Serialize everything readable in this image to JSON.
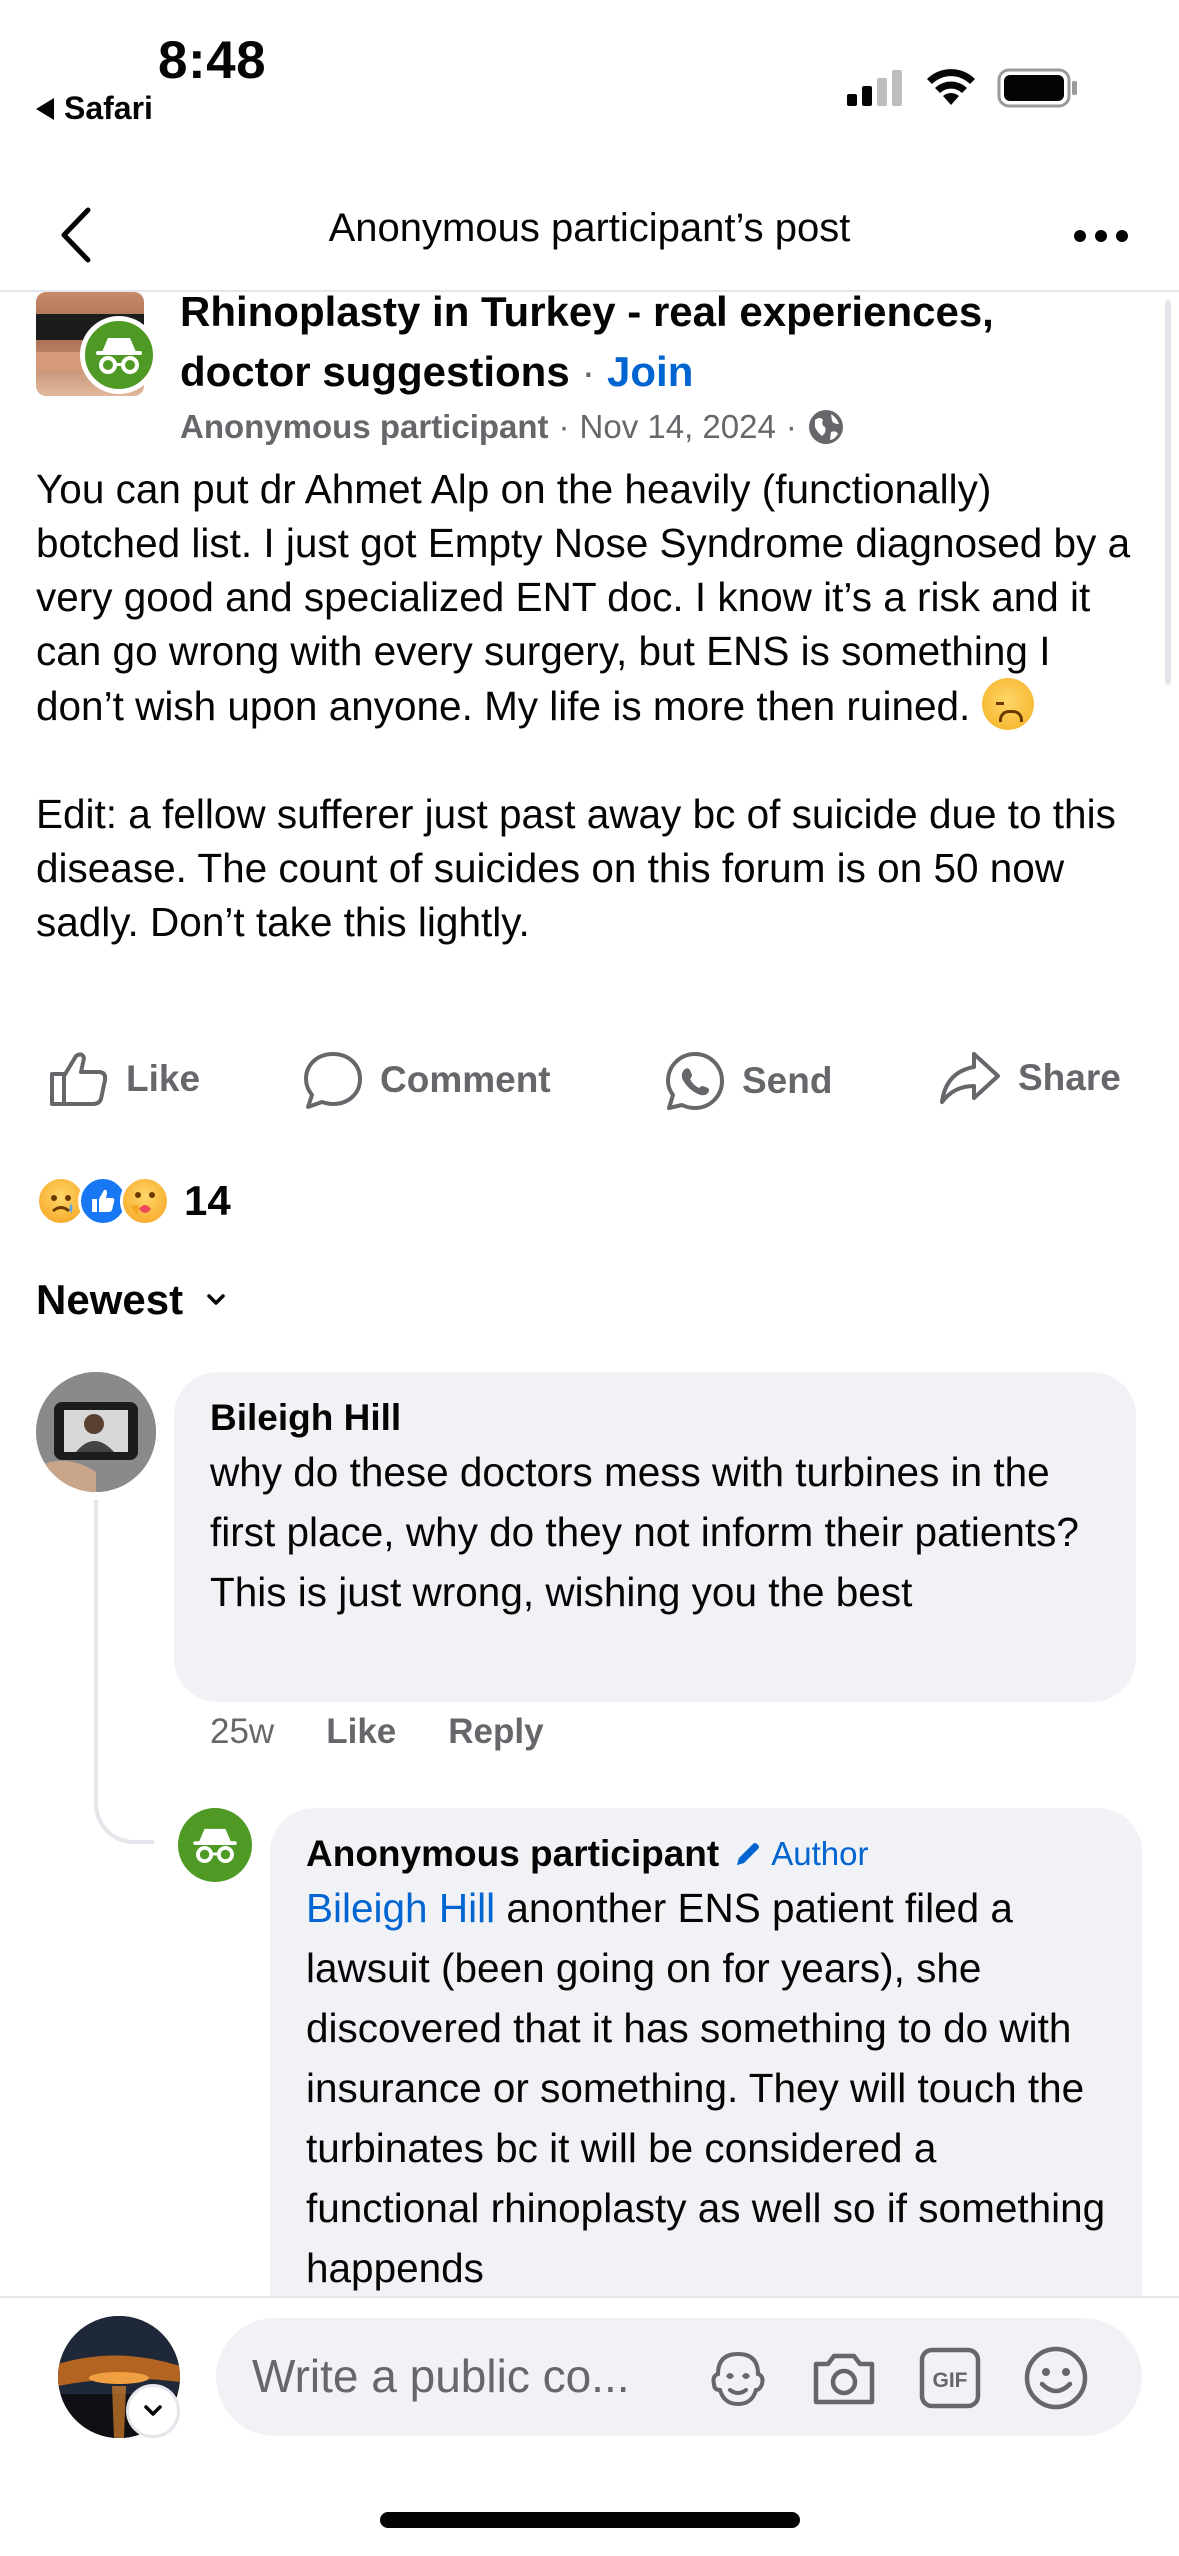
{
  "status": {
    "time": "8:48",
    "back_app": "Safari"
  },
  "nav": {
    "title": "Anonymous participant’s post"
  },
  "post": {
    "group_name": "Rhinoplasty in Turkey - real experiences, doctor suggestions",
    "separator": "·",
    "join_label": "Join",
    "author": "Anonymous participant",
    "meta_sep": "·",
    "date": "Nov 14, 2024",
    "meta_sep2": "·",
    "body_p1": "You can put dr Ahmet Alp on the heavily (functionally) botched list. I just got Empty Nose Syndrome diagnosed by a very good and specialized ENT doc. I know it’s a risk and it can go wrong with every surgery, but ENS is something I don’t wish upon anyone. My life is more then ruined. ",
    "body_p2": "Edit: a fellow sufferer just past away bc of suicide due to this disease. The count of suicides on this forum is on 50 now sadly. Don’t take this lightly."
  },
  "actions": {
    "like": "Like",
    "comment": "Comment",
    "send": "Send",
    "share": "Share"
  },
  "reactions": {
    "types": [
      "sad",
      "like",
      "care"
    ],
    "count": "14"
  },
  "sort": {
    "label": "Newest"
  },
  "comments": [
    {
      "name": "Bileigh Hill",
      "text": "why do these doctors mess with turbines in the first place, why do they not inform their patients? This is just wrong, wishing you the best",
      "time": "25w",
      "like_label": "Like",
      "reply_label": "Reply"
    },
    {
      "name": "Anonymous participant",
      "badge": "Author",
      "mention": "Bileigh Hill",
      "text": " anonther ENS patient filed a lawsuit (been going on for years), she discovered that it has something to do with insurance or something. They will touch the turbinates bc it will be considered a functional rhinoplasty as well so if something happends"
    }
  ],
  "composer": {
    "placeholder": "Write a public co..."
  },
  "colors": {
    "link_blue": "#0064d1",
    "secondary_text": "#65676b",
    "bubble_bg": "#f0f2f5",
    "anon_green": "#4f9a24"
  }
}
